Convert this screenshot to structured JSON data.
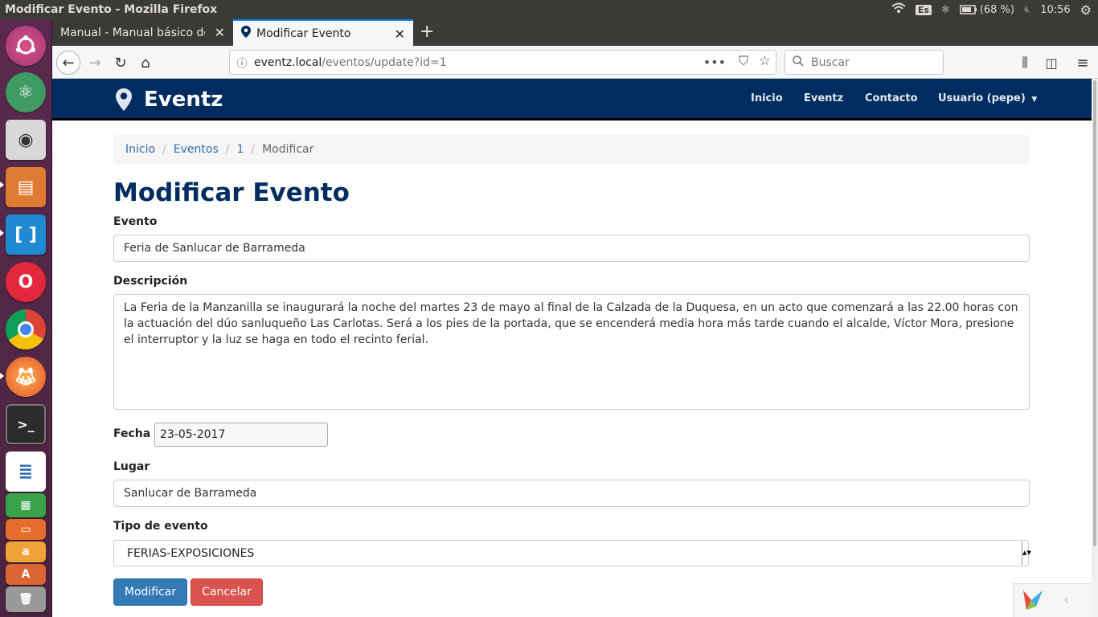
{
  "os": {
    "window_title": "Modificar Evento - Mozilla Firefox",
    "keyboard_layout": "Es",
    "battery": "(68 %)",
    "clock": "10:56",
    "launcher_items": [
      "ubuntu-dash",
      "atom",
      "camera",
      "files",
      "brackets",
      "opera",
      "chrome",
      "firefox",
      "terminal",
      "writer",
      "calc",
      "impress",
      "amazon",
      "software",
      "trash"
    ]
  },
  "browser": {
    "tabs": [
      {
        "label": "Manual - Manual básico de Git"
      },
      {
        "label": "Modificar Evento"
      }
    ],
    "url_host": "eventz.local",
    "url_path": "/eventos/update?id=1",
    "search_placeholder": "Buscar"
  },
  "site": {
    "brand": "Eventz",
    "nav": [
      "Inicio",
      "Eventz",
      "Contacto",
      "Usuario (pepe)"
    ]
  },
  "breadcrumb": {
    "items": [
      "Inicio",
      "Eventos",
      "1"
    ],
    "active": "Modificar"
  },
  "form": {
    "title": "Modificar Evento",
    "evento_label": "Evento",
    "evento_value": "Feria de Sanlucar de Barrameda",
    "descripcion_label": "Descripción",
    "descripcion_value": "La Feria de la Manzanilla se inaugurará la noche del martes 23 de mayo al final de la Calzada de la Duquesa, en un acto que comenzará a las 22.00 horas con la actuación del dúo sanluqueño Las Carlotas. Será a los pies de la portada, que se encenderá media hora más tarde cuando el alcalde, Víctor Mora, presione el interruptor y la luz se haga en todo el recinto ferial.",
    "fecha_label": "Fecha",
    "fecha_value": "23-05-2017",
    "lugar_label": "Lugar",
    "lugar_value": "Sanlucar de Barrameda",
    "tipo_label": "Tipo de evento",
    "tipo_value": "FERIAS-EXPOSICIONES",
    "submit_label": "Modificar",
    "cancel_label": "Cancelar"
  },
  "colors": {
    "navbar": "#002c5f",
    "primary": "#337ab7",
    "danger": "#d9534f"
  }
}
